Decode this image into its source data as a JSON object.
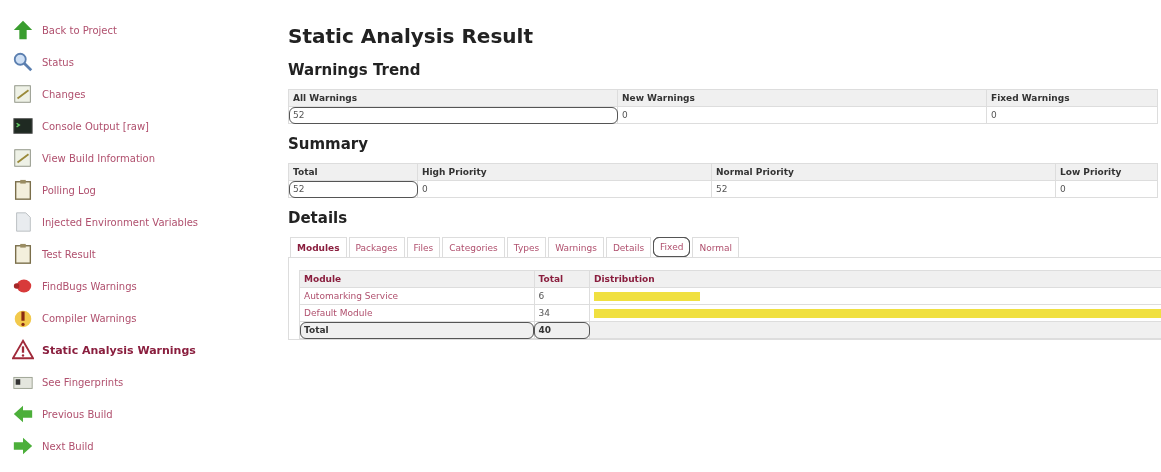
{
  "sidebar": {
    "items": [
      {
        "label": "Back to Project",
        "selected": false
      },
      {
        "label": "Status",
        "selected": false
      },
      {
        "label": "Changes",
        "selected": false
      },
      {
        "label": "Console Output [raw]",
        "selected": false
      },
      {
        "label": "View Build Information",
        "selected": false
      },
      {
        "label": "Polling Log",
        "selected": false
      },
      {
        "label": "Injected Environment Variables",
        "selected": false
      },
      {
        "label": "Test Result",
        "selected": false
      },
      {
        "label": "FindBugs Warnings",
        "selected": false
      },
      {
        "label": "Compiler Warnings",
        "selected": false
      },
      {
        "label": "Static Analysis Warnings",
        "selected": true
      },
      {
        "label": "See Fingerprints",
        "selected": false
      },
      {
        "label": "Previous Build",
        "selected": false
      },
      {
        "label": "Next Build",
        "selected": false
      }
    ]
  },
  "title": "Static Analysis Result",
  "warnings_trend": {
    "heading": "Warnings Trend",
    "columns": [
      {
        "label": "All Warnings",
        "value": "52",
        "highlighted": true
      },
      {
        "label": "New Warnings",
        "value": "0",
        "highlighted": false
      },
      {
        "label": "Fixed Warnings",
        "value": "0",
        "highlighted": false
      }
    ]
  },
  "summary": {
    "heading": "Summary",
    "columns": [
      {
        "label": "Total",
        "value": "52",
        "highlighted": true
      },
      {
        "label": "High Priority",
        "value": "0",
        "highlighted": false
      },
      {
        "label": "Normal Priority",
        "value": "52",
        "highlighted": false
      },
      {
        "label": "Low Priority",
        "value": "0",
        "highlighted": false
      }
    ]
  },
  "details": {
    "heading": "Details",
    "tabs": [
      {
        "label": "Modules",
        "selected": true,
        "highlighted": false
      },
      {
        "label": "Packages",
        "selected": false,
        "highlighted": false
      },
      {
        "label": "Files",
        "selected": false,
        "highlighted": false
      },
      {
        "label": "Categories",
        "selected": false,
        "highlighted": false
      },
      {
        "label": "Types",
        "selected": false,
        "highlighted": false
      },
      {
        "label": "Warnings",
        "selected": false,
        "highlighted": false
      },
      {
        "label": "Details",
        "selected": false,
        "highlighted": false
      },
      {
        "label": "Fixed",
        "selected": false,
        "highlighted": true
      },
      {
        "label": "Normal",
        "selected": false,
        "highlighted": false
      }
    ],
    "table": {
      "columns": [
        "Module",
        "Total",
        "Distribution"
      ],
      "rows": [
        {
          "module": "Automarking Service",
          "total": "6",
          "level": 0.176
        },
        {
          "module": "Default Module",
          "total": "34",
          "level": 1
        }
      ],
      "footer": {
        "label": "Total",
        "total": "40",
        "highlighted": true
      }
    }
  }
}
